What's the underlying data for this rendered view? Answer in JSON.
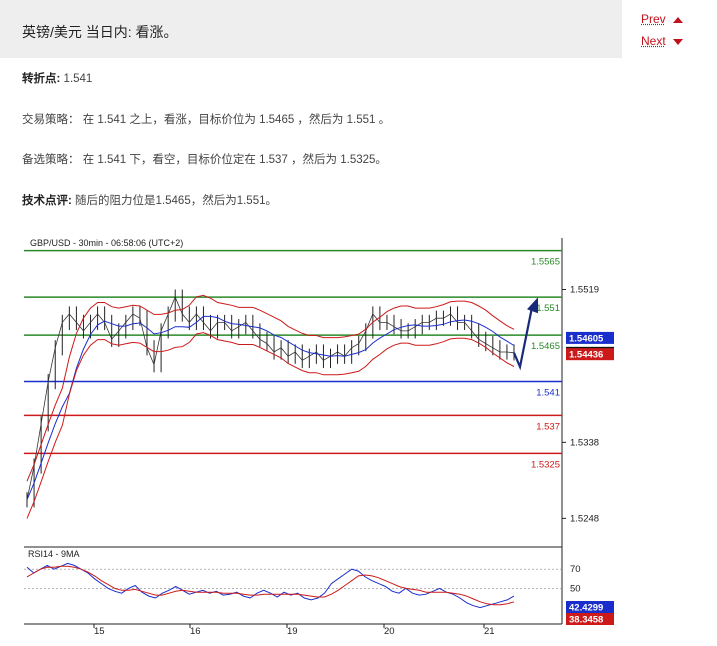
{
  "header": {
    "title": "英镑/美元 当日内: 看涨。"
  },
  "nav": {
    "prev_label": "Prev",
    "next_label": "Next"
  },
  "pivot": {
    "label": "转折点:",
    "value": "1.541"
  },
  "strategy": {
    "label": "交易策略：",
    "text": "在 1.541 之上，看涨，目标价位为 1.5465 ，然后为 1.551 。"
  },
  "alternative": {
    "label": "备选策略：",
    "text": "在 1.541 下，看空，目标价位定在 1.537 ，然后为 1.5325。"
  },
  "comment": {
    "label": "技术点评:",
    "text": "随后的阻力位是1.5465，然后为1.551。"
  },
  "chart_data": {
    "type": "line",
    "title": "GBP/USD - 30min - 06:58:06 (UTC+2)",
    "price_axis_ticks": [
      "1.5519",
      "1.5338",
      "1.5248"
    ],
    "date_ticks": [
      "15",
      "16",
      "19",
      "20",
      "21"
    ],
    "levels": [
      {
        "label": "1.5565",
        "value": 1.5565,
        "color": "#2a8a2a"
      },
      {
        "label": "1.551",
        "value": 1.551,
        "color": "#2a8a2a"
      },
      {
        "label": "1.5465",
        "value": 1.5465,
        "color": "#2a8a2a"
      },
      {
        "label": "1.541",
        "value": 1.541,
        "color": "#1a2ecc"
      },
      {
        "label": "1.537",
        "value": 1.537,
        "color": "#cc1a1a"
      },
      {
        "label": "1.5325",
        "value": 1.5325,
        "color": "#cc1a1a"
      }
    ],
    "ylim": [
      1.522,
      1.558
    ],
    "price_markers": [
      {
        "label": "1.54605",
        "color": "#1a2ecc"
      },
      {
        "label": "1.5444",
        "color": "#111111"
      },
      {
        "label": "1.54436",
        "color": "#cc1a1a"
      }
    ],
    "close_series": [
      1.527,
      1.531,
      1.536,
      1.541,
      1.545,
      1.548,
      1.549,
      1.548,
      1.547,
      1.548,
      1.549,
      1.548,
      1.546,
      1.547,
      1.548,
      1.549,
      1.5485,
      1.545,
      1.543,
      1.547,
      1.549,
      1.551,
      1.549,
      1.548,
      1.549,
      1.548,
      1.547,
      1.548,
      1.548,
      1.547,
      1.5475,
      1.548,
      1.547,
      1.546,
      1.5455,
      1.5445,
      1.545,
      1.544,
      1.5445,
      1.5435,
      1.544,
      1.5445,
      1.5435,
      1.544,
      1.5445,
      1.544,
      1.545,
      1.5455,
      1.547,
      1.549,
      1.548,
      1.548,
      1.5475,
      1.547,
      1.547,
      1.5475,
      1.548,
      1.548,
      1.5485,
      1.5485,
      1.549,
      1.548,
      1.548,
      1.547,
      1.546,
      1.5455,
      1.545,
      1.5445,
      1.5445,
      1.5444
    ],
    "rsi": {
      "label": "RSI14 - 9MA",
      "ticks": [
        "70",
        "50"
      ],
      "ylim": [
        15,
        90
      ],
      "value_markers": [
        {
          "label": "42.4299",
          "color": "#1a2ecc"
        },
        {
          "label": "38.3458",
          "color": "#cc1a1a"
        }
      ],
      "rsi_values": [
        72,
        66,
        70,
        74,
        70,
        73,
        76,
        74,
        70,
        66,
        60,
        55,
        50,
        47,
        45,
        50,
        53,
        46,
        42,
        40,
        45,
        48,
        52,
        48,
        44,
        46,
        48,
        45,
        47,
        43,
        44,
        46,
        42,
        40,
        45,
        48,
        45,
        41,
        46,
        43,
        45,
        40,
        38,
        40,
        45,
        55,
        60,
        65,
        70,
        68,
        62,
        58,
        55,
        52,
        47,
        45,
        50,
        45,
        43,
        44,
        47,
        50,
        46,
        44,
        40,
        35,
        32,
        30,
        32,
        34,
        36,
        38,
        42
      ],
      "ma_values": [
        62,
        66,
        70,
        72,
        72,
        73,
        73,
        72,
        70,
        67,
        63,
        58,
        54,
        50,
        48,
        48,
        49,
        47,
        45,
        43,
        43,
        45,
        47,
        48,
        47,
        46,
        46,
        46,
        46,
        45,
        45,
        45,
        44,
        43,
        43,
        44,
        44,
        44,
        44,
        44,
        44,
        43,
        42,
        41,
        41,
        44,
        48,
        53,
        58,
        63,
        64,
        63,
        61,
        58,
        55,
        52,
        50,
        49,
        48,
        46,
        46,
        46,
        46,
        45,
        44,
        42,
        39,
        36,
        34,
        33,
        33,
        34,
        36
      ]
    }
  }
}
